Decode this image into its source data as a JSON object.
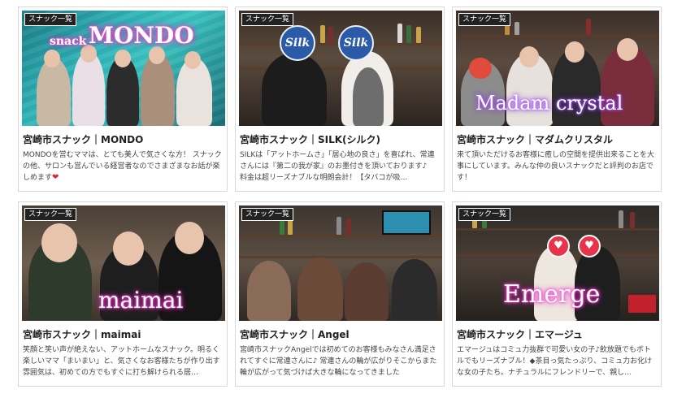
{
  "badge_label": "スナック一覧",
  "cards": [
    {
      "overlay_sub": "snack",
      "overlay_main": "MONDO",
      "title": "宮崎市スナック｜MONDO",
      "description": "MONDOを営むママは、とても美人で気さくな方！ スナックの他、サロンも営んでいる経営者なのでさまざまなお話が楽しめます"
    },
    {
      "overlay_main": "Silk",
      "title": "宮崎市スナック｜SILK(シルク)",
      "description": "SILKは「アットホームさ」「居心地の良さ」を喜ばれ、常連さんには『第二の我が家』のお墨付きを頂いております♪　料金は超リーズナブルな明朗会計！【タバコが吸…"
    },
    {
      "overlay_main": "Madam crystal",
      "title": "宮崎市スナック｜マダムクリスタル",
      "description": "来て頂いただけるお客様に癒しの空間を提供出来ることを大事にしています。みんな仲の良いスナックだと評判のお店です！"
    },
    {
      "overlay_main": "maimai",
      "title": "宮崎市スナック｜maimai",
      "description": "笑顔と笑い声が絶えない、アットホームなスナック。明るく楽しいママ「まいまい」と、気さくなお客様たちが作り出す雰囲気は、初めての方でもすぐに打ち解けられる居…"
    },
    {
      "title": "宮崎市スナック｜Angel",
      "description": "宮崎市スナックAngelでは初めてのお客様もみなさん満足されてすぐに常連さんに♪ 常連さんの輪が広がりそこからまた輪が広がって気づけば大きな輪になってきました"
    },
    {
      "overlay_main": "Emerge",
      "title": "宮崎市スナック｜エマージュ",
      "description": "エマージュはコミュ力抜群で可愛い女の子♪飲放題でもボトルでもリーズナブル！◆茶目っ気たっぷり、コミュ力お化けな女の子たち。ナチュラルにフレンドリーで、親し…"
    }
  ],
  "colors": {
    "card_border": "#d8d8d8",
    "badge_bg": "#222222",
    "overlay_glow_pink": "#ff3fd2",
    "overlay_glow_violet": "#a64dff"
  }
}
